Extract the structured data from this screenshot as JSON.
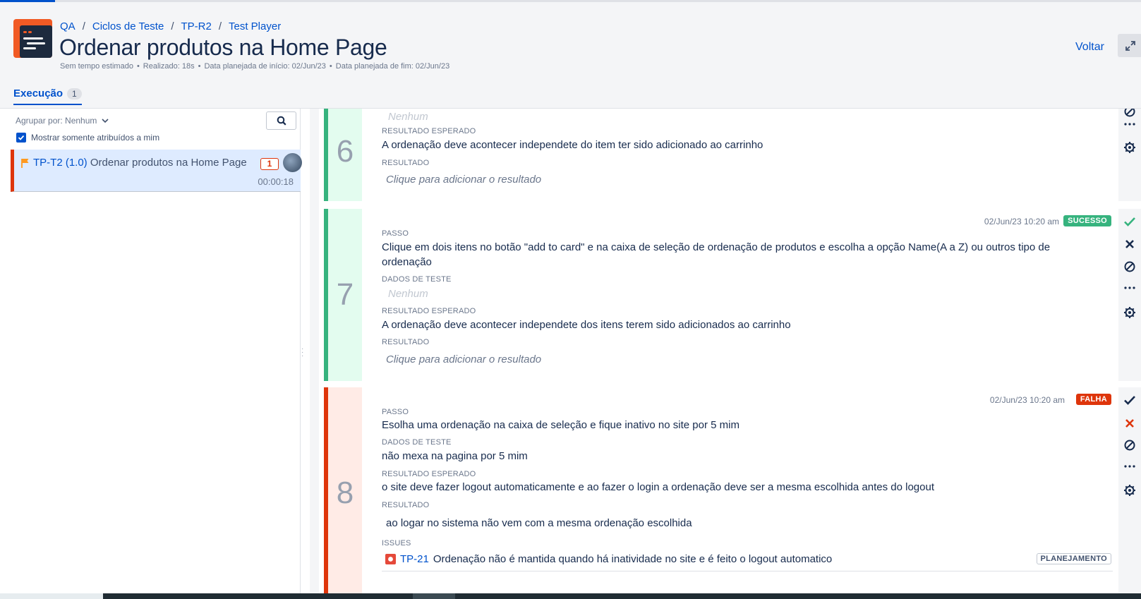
{
  "breadcrumb": [
    "QA",
    "Ciclos de Teste",
    "TP-R2",
    "Test Player"
  ],
  "title": "Ordenar produtos na Home Page",
  "meta": {
    "estimate": "Sem tempo estimado",
    "realized": "Realizado: 18s",
    "planned_start": "Data planejada de início: 02/Jun/23",
    "planned_end": "Data planejada de fim: 02/Jun/23"
  },
  "back_label": "Voltar",
  "tabs": [
    {
      "label": "Execução",
      "count": "1"
    }
  ],
  "sidebar": {
    "group_by": "Agrupar por: Nenhum",
    "only_mine": "Mostrar somente atribuídos a mim",
    "item": {
      "key": "TP-T2 (1.0)",
      "name": "Ordenar produtos na Home Page",
      "badge": "1",
      "time": "00:00:18"
    }
  },
  "labels": {
    "step": "PASSO",
    "test_data": "DADOS DE TESTE",
    "expected": "RESULTADO ESPERADO",
    "result": "RESULTADO",
    "issues": "ISSUES"
  },
  "steps": [
    {
      "number": "6",
      "test_data": "Nenhum",
      "expected": "A ordenação deve acontecer independete do item ter sido adicionado ao carrinho",
      "result_placeholder": "Clique para adicionar o resultado"
    },
    {
      "number": "7",
      "timestamp": "02/Jun/23 10:20 am",
      "status": "SUCESSO",
      "step": "Clique em dois itens no botão \"add to card\" e na caixa de seleção de ordenação de produtos e escolha a opção Name(A a Z) ou outros tipo de ordenação",
      "test_data": "Nenhum",
      "expected": "A ordenação deve acontecer independete dos itens terem sido adicionados ao carrinho",
      "result_placeholder": "Clique para adicionar o resultado"
    },
    {
      "number": "8",
      "timestamp": "02/Jun/23 10:20 am",
      "status": "FALHA",
      "step": "Esolha uma ordenação na caixa de seleção e fique inativo no site por 5 mim",
      "test_data": "não mexa na pagina por 5 mim",
      "expected": "o site deve fazer logout automaticamente e ao fazer o login a ordenação deve ser a mesma escolhida antes do logout",
      "result": "ao logar no sistema não vem com a mesma ordenação escolhida",
      "issue_key": "TP-21",
      "issue_text": "Ordenação não é mantida quando há inatividade no site e é feito o logout automatico",
      "issue_status": "PLANEJAMENTO"
    }
  ],
  "colors": {
    "brand": "#0052cc",
    "success": "#36b37e",
    "fail": "#de350b"
  }
}
